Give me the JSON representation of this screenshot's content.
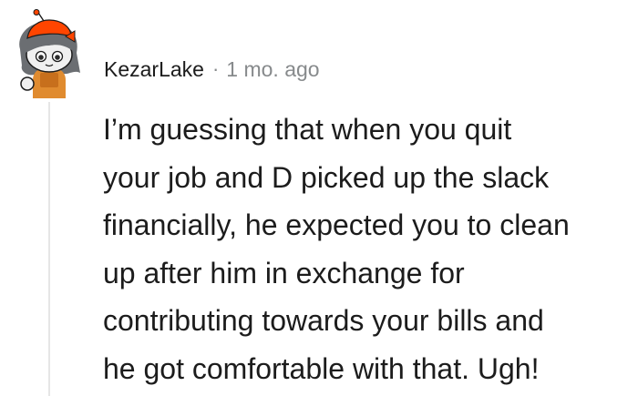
{
  "comment": {
    "author": "KezarLake",
    "separator": "·",
    "timestamp": "1 mo. ago",
    "body_lines": [
      "I’m guessing that when you quit",
      "your job and D picked up the slack",
      "financially, he expected you to clean",
      "up after him in exchange for",
      "contributing towards your bills and",
      "he got comfortable with that. Ugh!"
    ]
  },
  "avatar": {
    "icon": "snoo-avatar-icon",
    "colors": {
      "hair": "#6b6e72",
      "cap": "#ff4500",
      "skin": "#f0f0f0",
      "body": "#e08b2f",
      "bow": "#ff4500"
    }
  },
  "colors": {
    "text": "#1c1c1c",
    "meta": "#878a8c",
    "thread_line": "#e6e6e6"
  }
}
